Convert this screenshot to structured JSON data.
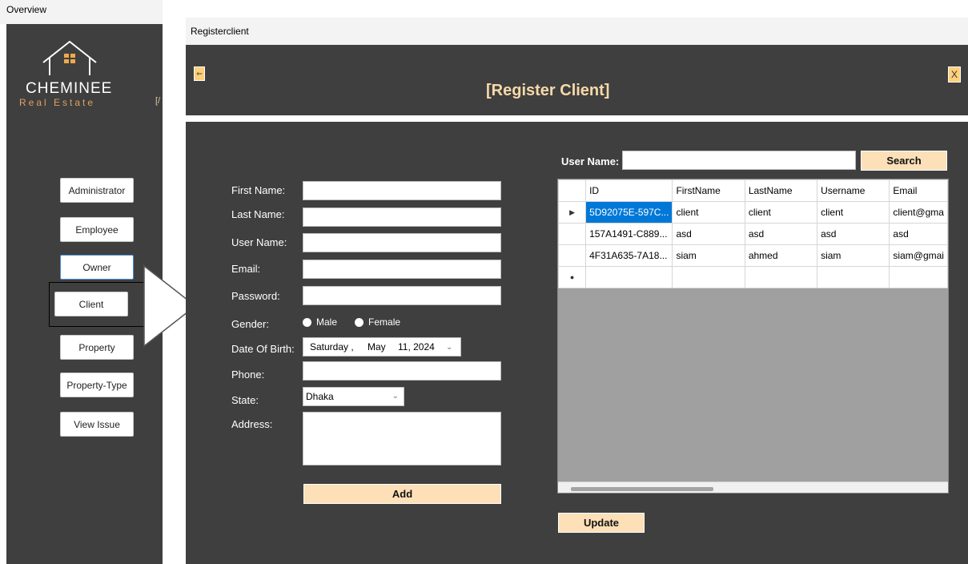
{
  "overview": {
    "window_title": "Overview",
    "logo_main": "CHEMINEE",
    "logo_sub": "Real Estate",
    "cut_text": "[/",
    "nav": [
      {
        "label": "Administrator"
      },
      {
        "label": "Employee"
      },
      {
        "label": "Owner"
      },
      {
        "label": "Client"
      },
      {
        "label": "Property"
      },
      {
        "label": "Property-Type"
      },
      {
        "label": "View Issue"
      }
    ]
  },
  "register": {
    "window_title": "Registerclient",
    "header_title": "[Register Client]",
    "back_icon": "⇐",
    "close_label": "X",
    "form": {
      "first_name": {
        "label": "First Name:",
        "value": ""
      },
      "last_name": {
        "label": "Last Name:",
        "value": ""
      },
      "user_name": {
        "label": "User Name:",
        "value": ""
      },
      "email": {
        "label": "Email:",
        "value": ""
      },
      "password": {
        "label": "Password:",
        "value": ""
      },
      "gender": {
        "label": "Gender:",
        "options": [
          "Male",
          "Female"
        ]
      },
      "dob": {
        "label": "Date Of Birth:",
        "weekday": "Saturday ,",
        "month": "May",
        "day_year": "11, 2024"
      },
      "phone": {
        "label": "Phone:",
        "value": ""
      },
      "state": {
        "label": "State:",
        "selected": "Dhaka"
      },
      "address": {
        "label": "Address:",
        "value": ""
      },
      "add_label": "Add"
    },
    "search": {
      "label": "User Name:",
      "value": "",
      "button_label": "Search"
    },
    "grid": {
      "columns": [
        "ID",
        "FirstName",
        "LastName",
        "Username",
        "Email"
      ],
      "rows": [
        {
          "marker": "▶",
          "cells": [
            "5D92075E-597C...",
            "client",
            "client",
            "client",
            "client@gma"
          ]
        },
        {
          "marker": "",
          "cells": [
            "157A1491-C889...",
            "asd",
            "asd",
            "asd",
            "asd"
          ]
        },
        {
          "marker": "",
          "cells": [
            "4F31A635-7A18...",
            "siam",
            "ahmed",
            "siam",
            "siam@gmai"
          ]
        },
        {
          "marker": "●",
          "cells": [
            "",
            "",
            "",
            "",
            ""
          ]
        }
      ]
    },
    "update_label": "Update"
  }
}
